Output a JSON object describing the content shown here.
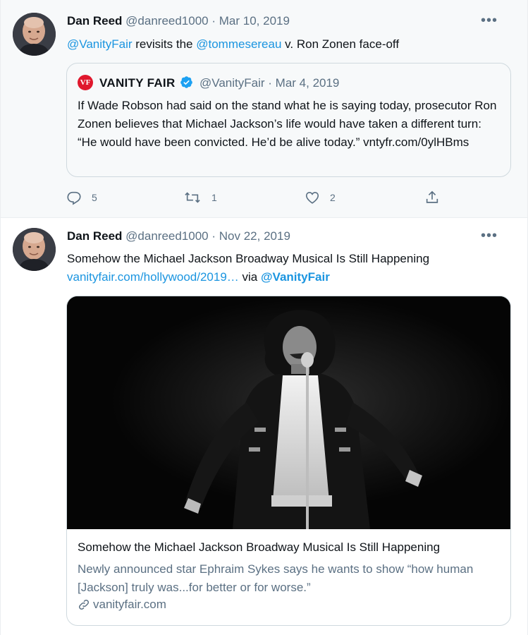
{
  "tweets": [
    {
      "author_name": "Dan Reed",
      "handle": "@danreed1000",
      "separator": "·",
      "date": "Mar 10, 2019",
      "text_parts": {
        "mention1": "@VanityFair",
        "middle": " revisits the ",
        "mention2": "@tommesereau",
        "end": " v. Ron Zonen face-off"
      },
      "quote": {
        "logo": "VF",
        "name": "VANITY FAIR",
        "handle": "@VanityFair",
        "separator": "·",
        "date": "Mar 4, 2019",
        "text": "If Wade Robson had said on the stand what he is saying today, prosecutor Ron Zonen believes that Michael Jackson’s life would have taken a different turn: “He would have been convicted. He’d be alive today.” vntyfr.com/0ylHBms"
      },
      "actions": {
        "reply_count": "5",
        "retweet_count": "1",
        "like_count": "2"
      }
    },
    {
      "author_name": "Dan Reed",
      "handle": "@danreed1000",
      "separator": "·",
      "date": "Nov 22, 2019",
      "text_line1": "Somehow the Michael Jackson Broadway Musical Is Still Happening",
      "link": "vanityfair.com/hollywood/2019…",
      "via": " via ",
      "via_mention": "@VanityFair",
      "card": {
        "title": "Somehow the Michael Jackson Broadway Musical Is Still Happening",
        "description": "Newly announced star Ephraim Sykes says he wants to show “how human [Jackson] truly was...for better or for worse.”",
        "domain": "vanityfair.com"
      }
    }
  ],
  "icons": {
    "more": "more-icon",
    "reply": "reply-icon",
    "retweet": "retweet-icon",
    "like": "like-icon",
    "share": "share-icon",
    "verified": "verified-badge-icon",
    "link": "link-icon"
  },
  "colors": {
    "accent": "#1b95e0",
    "muted": "#5b7083",
    "verified": "#1da1f2",
    "vf_red": "#e0182d"
  }
}
